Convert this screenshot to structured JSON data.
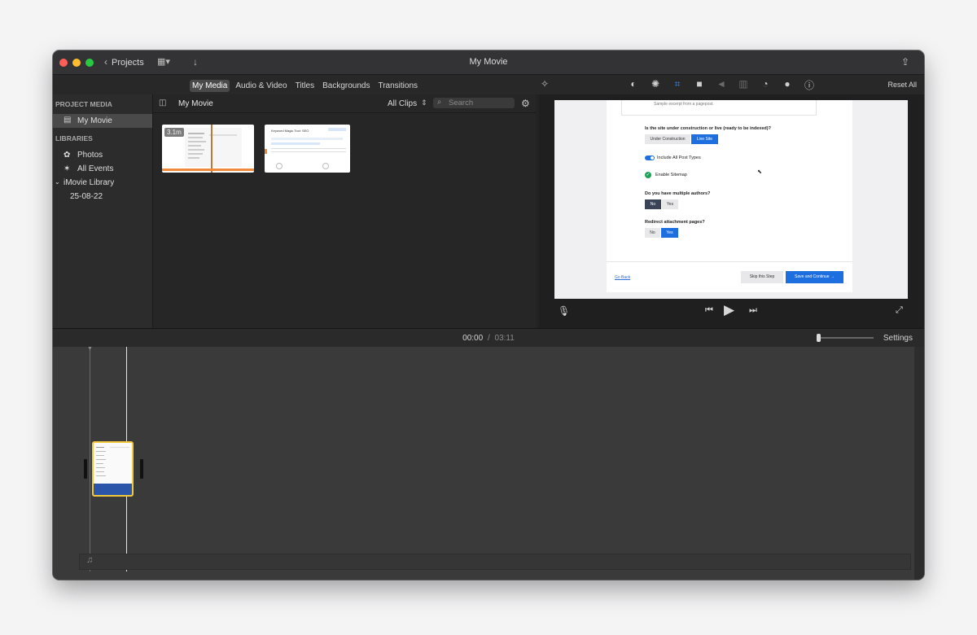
{
  "window": {
    "title": "My Movie",
    "back_label": "Projects"
  },
  "toolbar": {
    "tabs": [
      "My Media",
      "Audio & Video",
      "Titles",
      "Backgrounds",
      "Transitions"
    ],
    "active_tab": "My Media",
    "reset_all": "Reset All",
    "viewer_tools": [
      "color-balance-icon",
      "color-correction-icon",
      "crop-icon",
      "stabilization-icon",
      "volume-icon",
      "noise-reduction-icon",
      "speed-icon",
      "clip-filter-icon",
      "info-icon"
    ]
  },
  "sidebar": {
    "project_media_header": "PROJECT MEDIA",
    "project": "My Movie",
    "libraries_header": "LIBRARIES",
    "items": [
      "Photos",
      "All Events",
      "iMovie Library",
      "25-08-22"
    ]
  },
  "browser": {
    "title": "My Movie",
    "filter": "All Clips",
    "search_placeholder": "Search",
    "clips": [
      {
        "duration": "3.1m"
      },
      {
        "title": "Keyword Magic Tool: SEO"
      }
    ]
  },
  "viewer": {
    "page": {
      "top_text": "Sample excerpt from a pagepost.",
      "q1": "Is the site under construction or live (ready to be indexed)?",
      "q1_options": [
        "Under Construction",
        "Live Site"
      ],
      "toggle_label": "Include All Post Types",
      "check_label": "Enable Sitemap",
      "q2": "Do you have multiple authors?",
      "q2_options": [
        "No",
        "Yes"
      ],
      "q3": "Redirect attachment pages?",
      "q3_options": [
        "No",
        "Yes"
      ],
      "back": "Go Back",
      "skip": "Skip this Step",
      "save": "Save and Continue →"
    }
  },
  "timeline": {
    "current": "00:00",
    "separator": "/",
    "total": "03:11",
    "settings": "Settings"
  }
}
